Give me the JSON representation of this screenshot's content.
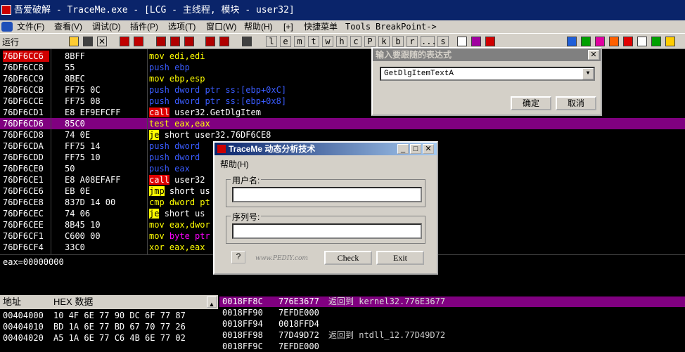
{
  "window": {
    "title": "吾爱破解 - TraceMe.exe - [LCG - 主线程, 模块 - user32]"
  },
  "menu": {
    "items": [
      "文件(F)",
      "查看(V)",
      "调试(D)",
      "插件(P)",
      "选项(T)",
      "窗口(W)",
      "帮助(H)",
      "[+]",
      "快捷菜单",
      "Tools",
      "BreakPoint->"
    ]
  },
  "toolbar": {
    "status": "运行",
    "letters": [
      "l",
      "e",
      "m",
      "t",
      "w",
      "h",
      "c",
      "P",
      "k",
      "b",
      "r",
      "...",
      "s"
    ]
  },
  "disasm": {
    "rows": [
      {
        "addr": "76DF6CC6",
        "hex": "8BFF",
        "op": "mov",
        "args": "edi,edi",
        "style": "kw-y"
      },
      {
        "addr": "76DF6CC8",
        "hex": "55",
        "op": "push",
        "args": "ebp",
        "style": "kw-b"
      },
      {
        "addr": "76DF6CC9",
        "hex": "8BEC",
        "op": "mov",
        "args": "ebp,esp",
        "style": "kw-y"
      },
      {
        "addr": "76DF6CCB",
        "hex": "FF75 0C",
        "op": "push",
        "args": "dword ptr ss:[ebp+0xC]",
        "style": "kw-b"
      },
      {
        "addr": "76DF6CCE",
        "hex": "FF75 08",
        "op": "push",
        "args": "dword ptr ss:[ebp+0x8]",
        "style": "kw-b"
      },
      {
        "addr": "76DF6CD1",
        "hex": "E8 EF9EFCFF",
        "op": "call",
        "args": "user32.GetDlgItem",
        "style": "kw-call"
      },
      {
        "addr": "76DF6CD6",
        "hex": "85C0",
        "op": "test",
        "args": "eax,eax",
        "style": "kw-y"
      },
      {
        "addr": "76DF6CD8",
        "hex": "74 0E",
        "op": "je",
        "args": "short user32.76DF6CE8",
        "style": "kw-je"
      },
      {
        "addr": "76DF6CDA",
        "hex": "FF75 14",
        "op": "push",
        "args": "dword ",
        "style": "kw-b"
      },
      {
        "addr": "76DF6CDD",
        "hex": "FF75 10",
        "op": "push",
        "args": "dword ",
        "style": "kw-b"
      },
      {
        "addr": "76DF6CE0",
        "hex": "50",
        "op": "push",
        "args": "eax",
        "style": "kw-b"
      },
      {
        "addr": "76DF6CE1",
        "hex": "E8 A08EFAFF",
        "op": "call",
        "args": "user32",
        "style": "kw-call"
      },
      {
        "addr": "76DF6CE6",
        "hex": "EB 0E",
        "op": "jmp",
        "args": "short us",
        "style": "kw-je"
      },
      {
        "addr": "76DF6CE8",
        "hex": "837D 14 00",
        "op": "cmp",
        "args": "dword pt",
        "style": "kw-y"
      },
      {
        "addr": "76DF6CEC",
        "hex": "74 06",
        "op": "je",
        "args": "short us",
        "style": "kw-je"
      },
      {
        "addr": "76DF6CEE",
        "hex": "8B45 10",
        "op": "mov",
        "args": "eax,dwor",
        "style": "kw-y"
      },
      {
        "addr": "76DF6CF1",
        "hex": "C600 00",
        "op": "mov",
        "args": "byte ptr",
        "style": "kw-y"
      },
      {
        "addr": "76DF6CF4",
        "hex": "33C0",
        "op": "xor",
        "args": "eax,eax",
        "style": "kw-y"
      }
    ]
  },
  "info": {
    "text": "eax=00000000"
  },
  "dump": {
    "addr_header": "地址",
    "hex_header": "HEX 数据",
    "rows": [
      {
        "addr": "00404000",
        "hex": "10 4F 6E 77 90 DC 6F 77 87"
      },
      {
        "addr": "00404010",
        "hex": "BD 1A 6E 77 BD 67 70 77 26"
      },
      {
        "addr": "00404020",
        "hex": "A5 1A 6E 77 C6 4B 6E 77 02"
      }
    ]
  },
  "stack": {
    "rows": [
      {
        "addr": "0018FF8C",
        "val": "776E3677",
        "comment": "返回到 kernel32.776E3677"
      },
      {
        "addr": "0018FF90",
        "val": "7EFDE000",
        "comment": ""
      },
      {
        "addr": "0018FF94",
        "val": "0018FFD4",
        "comment": ""
      },
      {
        "addr": "0018FF98",
        "val": "77D49D72",
        "comment": "返回到 ntdll_12.77D49D72"
      },
      {
        "addr": "0018FF9C",
        "val": "7EFDE000",
        "comment": ""
      }
    ]
  },
  "expr_dialog": {
    "title": "输入要跟随的表达式",
    "value": "GetDlgItemTextA",
    "ok": "确定",
    "cancel": "取消"
  },
  "traceme": {
    "title": "TraceMe 动态分析技术",
    "menu_help": "帮助(H)",
    "user_label": "用户名:",
    "serial_label": "序列号:",
    "q": "?",
    "watermark": "www.PEDIY.com",
    "check": "Check",
    "exit": "Exit"
  },
  "colors": {
    "accent": "#0a246a",
    "highlight": "#800080",
    "call_bg": "#e00000"
  }
}
